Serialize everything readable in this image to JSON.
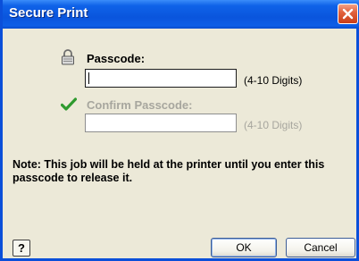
{
  "window": {
    "title": "Secure Print"
  },
  "passcode": {
    "label": "Passcode:",
    "value": "",
    "hint": "(4-10 Digits)"
  },
  "confirm": {
    "label": "Confirm Passcode:",
    "value": "",
    "hint": "(4-10 Digits)"
  },
  "note": "Note:  This job will be held at the printer until you enter this passcode to release it.",
  "buttons": {
    "help": "?",
    "ok": "OK",
    "cancel": "Cancel"
  },
  "icons": {
    "lock": "lock-icon",
    "check": "check-icon",
    "close": "close-icon"
  },
  "colors": {
    "titlebar": "#0a55dd",
    "dialog_bg": "#ece9d8",
    "disabled_text": "#a7a69e",
    "check_green": "#2e9a2e",
    "close_red": "#e2633f"
  }
}
